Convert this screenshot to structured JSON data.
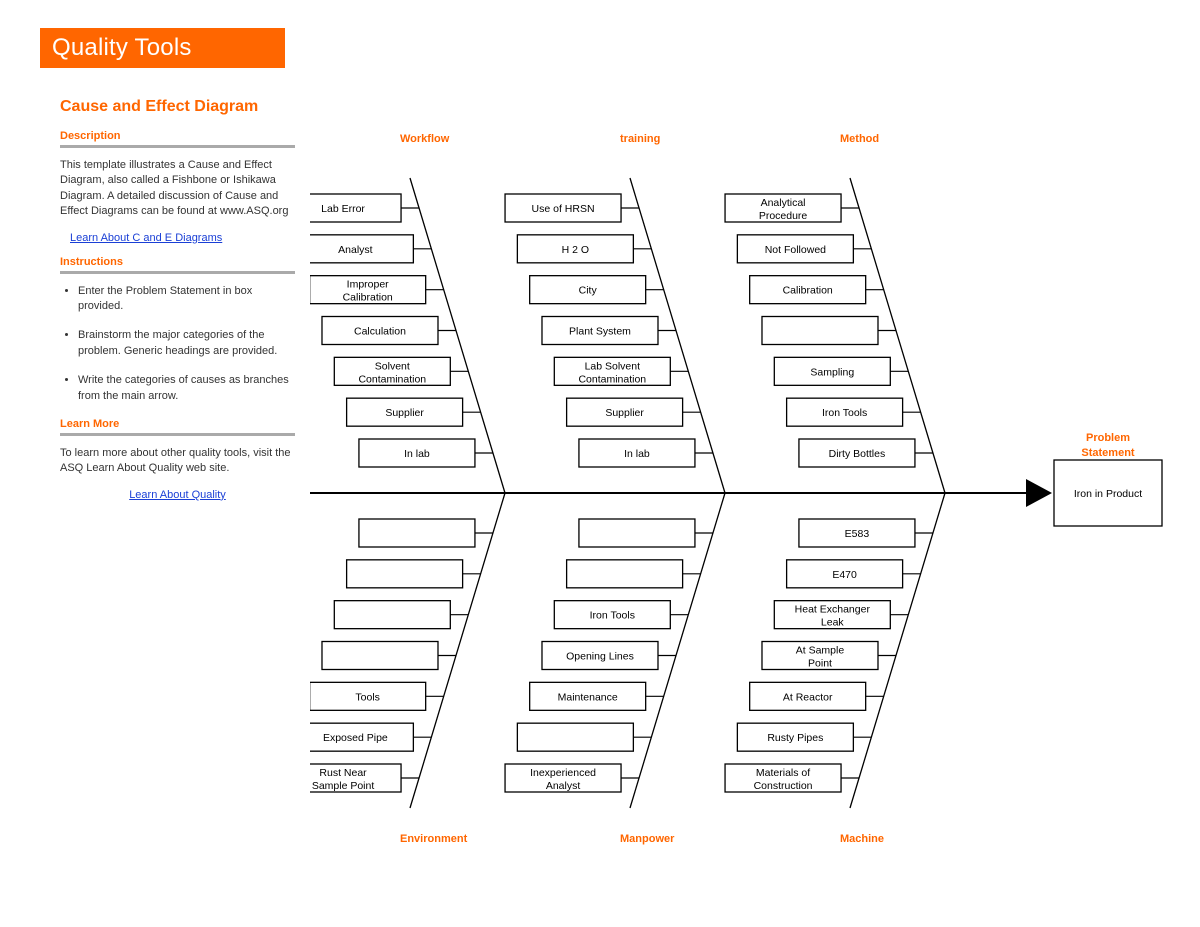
{
  "banner": "Quality Tools",
  "title": "Cause and Effect Diagram",
  "sections": {
    "description": {
      "heading": "Description",
      "text": "This template illustrates a Cause and Effect Diagram, also called a Fishbone or Ishikawa Diagram.  A detailed discussion of Cause and Effect Diagrams can be found at www.ASQ.org",
      "link": "Learn About C and E Diagrams"
    },
    "instructions": {
      "heading": "Instructions",
      "items": [
        "Enter the Problem Statement in box provided.",
        "Brainstorm the major categories of the problem. Generic headings are provided.",
        "Write the categories of causes as branches from the main arrow."
      ]
    },
    "learn": {
      "heading": "Learn More",
      "text": "To learn more about other quality tools, visit the ASQ Learn About Quality web site.",
      "link": "Learn About Quality"
    }
  },
  "problem_statement": {
    "heading": "Problem Statement",
    "value": "Iron in Product"
  },
  "categories": {
    "top": [
      {
        "label": "Workflow",
        "causes": [
          "Lab Error",
          "Analyst",
          "Improper Calibration",
          "Calculation",
          "Solvent Contamination",
          "Supplier",
          "In lab"
        ]
      },
      {
        "label": "training",
        "causes": [
          "Use of HRSN",
          "H 2 O",
          "City",
          "Plant System",
          "Lab Solvent Contamination",
          "Supplier",
          "In lab"
        ]
      },
      {
        "label": "Method",
        "causes": [
          "Analytical Procedure",
          "Not Followed",
          "Calibration",
          "",
          "Sampling",
          "Iron Tools",
          "Dirty Bottles"
        ]
      }
    ],
    "bottom": [
      {
        "label": "Environment",
        "causes": [
          "Rust Near Sample Point",
          "Exposed Pipe",
          "Tools",
          "",
          "",
          "",
          ""
        ]
      },
      {
        "label": "Manpower",
        "causes": [
          "Inexperienced Analyst",
          "",
          "Maintenance",
          "Opening Lines",
          "Iron Tools",
          "",
          ""
        ]
      },
      {
        "label": "Machine",
        "causes": [
          "Materials of Construction",
          "Rusty Pipes",
          "At Reactor",
          "At Sample Point",
          "Heat Exchanger Leak",
          "E470",
          "E583"
        ]
      }
    ]
  }
}
